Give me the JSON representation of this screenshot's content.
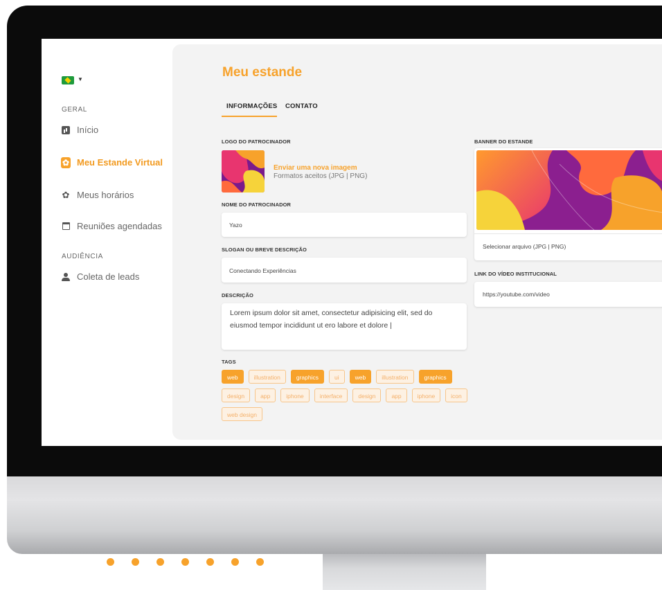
{
  "colors": {
    "accent": "#f7a22b",
    "bezel": "#0b0b0b",
    "panel": "#f3f3f3"
  },
  "sidebar": {
    "language_flag": "brazil-flag-icon",
    "sections": [
      {
        "label": "GERAL"
      },
      {
        "label": "AUDIÊNCIA"
      }
    ],
    "items": [
      {
        "label": "Início",
        "icon": "chart-icon",
        "active": false
      },
      {
        "label": "Meu Estande Virtual",
        "icon": "gear-icon",
        "active": true
      },
      {
        "label": "Meus horários",
        "icon": "gear-icon",
        "active": false
      },
      {
        "label": "Reuniões agendadas",
        "icon": "calendar-icon",
        "active": false
      },
      {
        "label": "Coleta de leads",
        "icon": "user-icon",
        "active": false
      }
    ]
  },
  "main": {
    "title": "Meu estande",
    "tabs": [
      {
        "label": "INFORMAÇÕES",
        "active": true
      },
      {
        "label": "CONTATO",
        "active": false
      }
    ],
    "logo": {
      "label": "LOGO DO PATROCINADOR",
      "upload_label": "Enviar uma nova imagem",
      "formats": "Formatos aceitos (JPG | PNG)"
    },
    "sponsor_name": {
      "label": "NOME DO PATROCINADOR",
      "value": "Yazo"
    },
    "slogan": {
      "label": "SLOGAN OU BREVE DESCRIÇÃO",
      "value": "Conectando Experiências"
    },
    "description": {
      "label": "DESCRIÇÃO",
      "value": "Lorem ipsum dolor sit amet, consectetur adipisicing elit, sed do eiusmod tempor incididunt ut ero labore et dolore |"
    },
    "tags": {
      "label": "TAGS",
      "items": [
        {
          "text": "web",
          "selected": true
        },
        {
          "text": "illustration",
          "selected": false
        },
        {
          "text": "graphics",
          "selected": true
        },
        {
          "text": "ui",
          "selected": false
        },
        {
          "text": "web",
          "selected": true
        },
        {
          "text": "illustration",
          "selected": false
        },
        {
          "text": "graphics",
          "selected": true
        },
        {
          "text": "design",
          "selected": false
        },
        {
          "text": "app",
          "selected": false
        },
        {
          "text": "iphone",
          "selected": false
        },
        {
          "text": "interface",
          "selected": false
        },
        {
          "text": "design",
          "selected": false
        },
        {
          "text": "app",
          "selected": false
        },
        {
          "text": "iphone",
          "selected": false
        },
        {
          "text": "icon",
          "selected": false
        },
        {
          "text": "web design",
          "selected": false
        }
      ]
    },
    "banner": {
      "label": "BANNER DO ESTANDE",
      "file_placeholder": "Selecionar arquivo (JPG | PNG)"
    },
    "video": {
      "label": "LINK DO VÍDEO INSTITUCIONAL",
      "value": "https://youtube.com/video"
    }
  }
}
